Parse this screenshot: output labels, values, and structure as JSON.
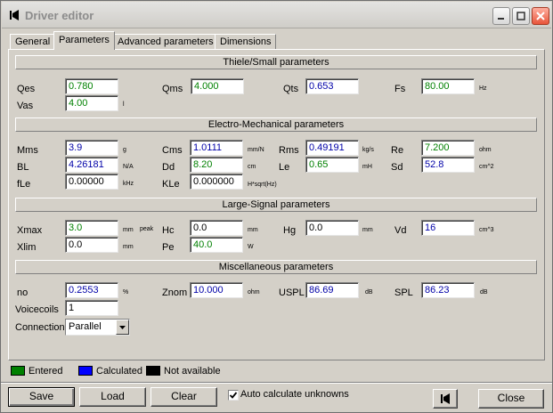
{
  "window": {
    "title": "Driver editor"
  },
  "tabs": [
    {
      "label": "General"
    },
    {
      "label": "Parameters"
    },
    {
      "label": "Advanced parameters"
    },
    {
      "label": "Dimensions"
    }
  ],
  "sections": {
    "ts": "Thiele/Small parameters",
    "em": "Electro-Mechanical parameters",
    "ls": "Large-Signal parameters",
    "misc": "Miscellaneous parameters"
  },
  "ts": {
    "qes": {
      "label": "Qes",
      "value": "0.780"
    },
    "qms": {
      "label": "Qms",
      "value": "4.000"
    },
    "qts": {
      "label": "Qts",
      "value": "0.653"
    },
    "fs": {
      "label": "Fs",
      "value": "80.00",
      "unit": "Hz"
    },
    "vas": {
      "label": "Vas",
      "value": "4.00",
      "unit": "l"
    }
  },
  "em": {
    "mms": {
      "label": "Mms",
      "value": "3.9",
      "unit": "g"
    },
    "cms": {
      "label": "Cms",
      "value": "1.0111",
      "unit": "mm/N"
    },
    "rms": {
      "label": "Rms",
      "value": "0.49191",
      "unit": "kg/s"
    },
    "re": {
      "label": "Re",
      "value": "7.200",
      "unit": "ohm"
    },
    "bl": {
      "label": "BL",
      "value": "4.26181",
      "unit": "N/A"
    },
    "dd": {
      "label": "Dd",
      "value": "8.20",
      "unit": "cm"
    },
    "le": {
      "label": "Le",
      "value": "0.65",
      "unit": "mH"
    },
    "sd": {
      "label": "Sd",
      "value": "52.8",
      "unit": "cm^2"
    },
    "fle": {
      "label": "fLe",
      "value": "0.00000",
      "unit": "kHz"
    },
    "kle": {
      "label": "KLe",
      "value": "0.000000",
      "unit": "H*sqrt(Hz)"
    }
  },
  "ls": {
    "xmax": {
      "label": "Xmax",
      "value": "3.0",
      "unit": "mm",
      "unit2": "peak"
    },
    "hc": {
      "label": "Hc",
      "value": "0.0",
      "unit": "mm"
    },
    "hg": {
      "label": "Hg",
      "value": "0.0",
      "unit": "mm"
    },
    "vd": {
      "label": "Vd",
      "value": "16",
      "unit": "cm^3"
    },
    "xlim": {
      "label": "Xlim",
      "value": "0.0",
      "unit": "mm"
    },
    "pe": {
      "label": "Pe",
      "value": "40.0",
      "unit": "W"
    }
  },
  "misc": {
    "no": {
      "label": "no",
      "value": "0.2553",
      "unit": "%"
    },
    "znom": {
      "label": "Znom",
      "value": "10.000",
      "unit": "ohm"
    },
    "uspl": {
      "label": "USPL",
      "value": "86.69",
      "unit": "dB"
    },
    "spl": {
      "label": "SPL",
      "value": "86.23",
      "unit": "dB"
    },
    "voicecoils": {
      "label": "Voicecoils",
      "value": "1"
    },
    "connection": {
      "label": "Connection",
      "value": "Parallel"
    }
  },
  "legend": {
    "entered": {
      "label": "Entered",
      "color": "#008000"
    },
    "calculated": {
      "label": "Calculated",
      "color": "#0000ff"
    },
    "na": {
      "label": "Not available",
      "color": "#000000"
    }
  },
  "buttons": {
    "save": "Save",
    "load": "Load",
    "clear": "Clear",
    "close": "Close"
  },
  "auto_calc": {
    "label": "Auto calculate unknowns",
    "checked": true
  }
}
